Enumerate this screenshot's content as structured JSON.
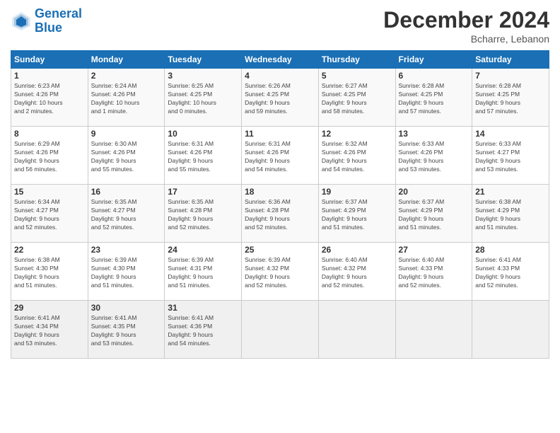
{
  "header": {
    "logo_line1": "General",
    "logo_line2": "Blue",
    "month": "December 2024",
    "location": "Bcharre, Lebanon"
  },
  "weekdays": [
    "Sunday",
    "Monday",
    "Tuesday",
    "Wednesday",
    "Thursday",
    "Friday",
    "Saturday"
  ],
  "weeks": [
    [
      {
        "day": "1",
        "sunrise": "6:23 AM",
        "sunset": "4:26 PM",
        "daylight": "10 hours and 2 minutes."
      },
      {
        "day": "2",
        "sunrise": "6:24 AM",
        "sunset": "4:26 PM",
        "daylight": "10 hours and 1 minute."
      },
      {
        "day": "3",
        "sunrise": "6:25 AM",
        "sunset": "4:25 PM",
        "daylight": "10 hours and 0 minutes."
      },
      {
        "day": "4",
        "sunrise": "6:26 AM",
        "sunset": "4:25 PM",
        "daylight": "9 hours and 59 minutes."
      },
      {
        "day": "5",
        "sunrise": "6:27 AM",
        "sunset": "4:25 PM",
        "daylight": "9 hours and 58 minutes."
      },
      {
        "day": "6",
        "sunrise": "6:28 AM",
        "sunset": "4:25 PM",
        "daylight": "9 hours and 57 minutes."
      },
      {
        "day": "7",
        "sunrise": "6:28 AM",
        "sunset": "4:25 PM",
        "daylight": "9 hours and 57 minutes."
      }
    ],
    [
      {
        "day": "8",
        "sunrise": "6:29 AM",
        "sunset": "4:26 PM",
        "daylight": "9 hours and 56 minutes."
      },
      {
        "day": "9",
        "sunrise": "6:30 AM",
        "sunset": "4:26 PM",
        "daylight": "9 hours and 55 minutes."
      },
      {
        "day": "10",
        "sunrise": "6:31 AM",
        "sunset": "4:26 PM",
        "daylight": "9 hours and 55 minutes."
      },
      {
        "day": "11",
        "sunrise": "6:31 AM",
        "sunset": "4:26 PM",
        "daylight": "9 hours and 54 minutes."
      },
      {
        "day": "12",
        "sunrise": "6:32 AM",
        "sunset": "4:26 PM",
        "daylight": "9 hours and 54 minutes."
      },
      {
        "day": "13",
        "sunrise": "6:33 AM",
        "sunset": "4:26 PM",
        "daylight": "9 hours and 53 minutes."
      },
      {
        "day": "14",
        "sunrise": "6:33 AM",
        "sunset": "4:27 PM",
        "daylight": "9 hours and 53 minutes."
      }
    ],
    [
      {
        "day": "15",
        "sunrise": "6:34 AM",
        "sunset": "4:27 PM",
        "daylight": "9 hours and 52 minutes."
      },
      {
        "day": "16",
        "sunrise": "6:35 AM",
        "sunset": "4:27 PM",
        "daylight": "9 hours and 52 minutes."
      },
      {
        "day": "17",
        "sunrise": "6:35 AM",
        "sunset": "4:28 PM",
        "daylight": "9 hours and 52 minutes."
      },
      {
        "day": "18",
        "sunrise": "6:36 AM",
        "sunset": "4:28 PM",
        "daylight": "9 hours and 52 minutes."
      },
      {
        "day": "19",
        "sunrise": "6:37 AM",
        "sunset": "4:29 PM",
        "daylight": "9 hours and 51 minutes."
      },
      {
        "day": "20",
        "sunrise": "6:37 AM",
        "sunset": "4:29 PM",
        "daylight": "9 hours and 51 minutes."
      },
      {
        "day": "21",
        "sunrise": "6:38 AM",
        "sunset": "4:29 PM",
        "daylight": "9 hours and 51 minutes."
      }
    ],
    [
      {
        "day": "22",
        "sunrise": "6:38 AM",
        "sunset": "4:30 PM",
        "daylight": "9 hours and 51 minutes."
      },
      {
        "day": "23",
        "sunrise": "6:39 AM",
        "sunset": "4:30 PM",
        "daylight": "9 hours and 51 minutes."
      },
      {
        "day": "24",
        "sunrise": "6:39 AM",
        "sunset": "4:31 PM",
        "daylight": "9 hours and 51 minutes."
      },
      {
        "day": "25",
        "sunrise": "6:39 AM",
        "sunset": "4:32 PM",
        "daylight": "9 hours and 52 minutes."
      },
      {
        "day": "26",
        "sunrise": "6:40 AM",
        "sunset": "4:32 PM",
        "daylight": "9 hours and 52 minutes."
      },
      {
        "day": "27",
        "sunrise": "6:40 AM",
        "sunset": "4:33 PM",
        "daylight": "9 hours and 52 minutes."
      },
      {
        "day": "28",
        "sunrise": "6:41 AM",
        "sunset": "4:33 PM",
        "daylight": "9 hours and 52 minutes."
      }
    ],
    [
      {
        "day": "29",
        "sunrise": "6:41 AM",
        "sunset": "4:34 PM",
        "daylight": "9 hours and 53 minutes."
      },
      {
        "day": "30",
        "sunrise": "6:41 AM",
        "sunset": "4:35 PM",
        "daylight": "9 hours and 53 minutes."
      },
      {
        "day": "31",
        "sunrise": "6:41 AM",
        "sunset": "4:36 PM",
        "daylight": "9 hours and 54 minutes."
      },
      null,
      null,
      null,
      null
    ]
  ]
}
